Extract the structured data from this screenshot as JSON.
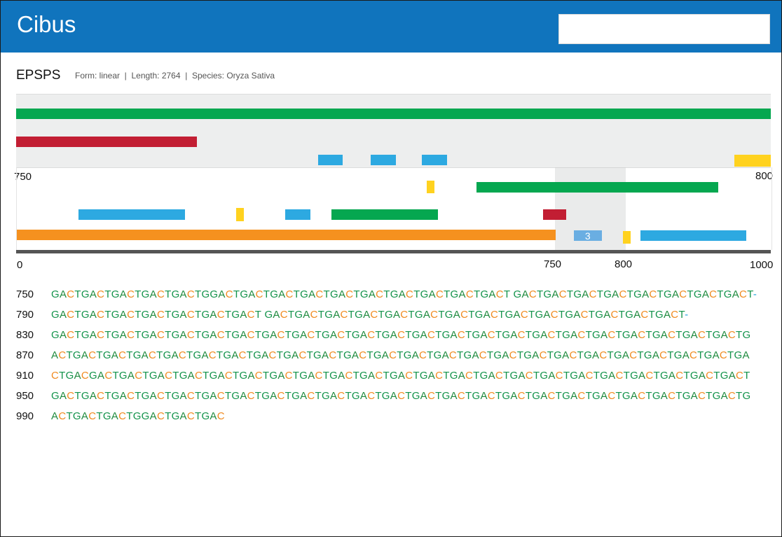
{
  "app": {
    "title": "Cibus"
  },
  "search": {
    "value": "",
    "placeholder": ""
  },
  "gene": {
    "name": "EPSPS",
    "meta": "Form: linear  |  Length: 2764  |  Species: Oryza Sativa"
  },
  "overview_features": [
    {
      "color": "#05a750",
      "start": 0,
      "end": 1000
    },
    {
      "color": "#c21e33",
      "start": 0,
      "end": 240
    },
    {
      "color": "#2da9e1",
      "start": 400,
      "end": 433
    },
    {
      "color": "#2da9e1",
      "start": 470,
      "end": 503
    },
    {
      "color": "#2da9e1",
      "start": 538,
      "end": 571
    },
    {
      "color": "#ffd21f",
      "start": 952,
      "end": 1000
    }
  ],
  "zoom_range": {
    "start_label": "750",
    "end_label": "800"
  },
  "detail_features": [
    {
      "color": "#ffd21f",
      "start": 543,
      "end": 553
    },
    {
      "color": "#05a750",
      "start": 609,
      "end": 929
    },
    {
      "color": "#2da9e1",
      "start": 82,
      "end": 223
    },
    {
      "color": "#ffd21f",
      "start": 291,
      "end": 301
    },
    {
      "color": "#2da9e1",
      "start": 356,
      "end": 389
    },
    {
      "color": "#05a750",
      "start": 417,
      "end": 558
    },
    {
      "color": "#c21e33",
      "start": 697,
      "end": 728
    },
    {
      "color": "#f5911f",
      "start": 0,
      "end": 714
    },
    {
      "color": "#6aaee2",
      "start": 738,
      "end": 775,
      "label": "3"
    },
    {
      "color": "#ffd21f",
      "start": 803,
      "end": 813
    },
    {
      "color": "#2da9e1",
      "start": 826,
      "end": 967
    }
  ],
  "axis_ticks": [
    "0",
    "750",
    "800",
    "1000"
  ],
  "sequence": [
    {
      "num": "750",
      "text": "GACTGACTGACTGACTGACTGGACTGACTGACTGACTGACTGACTGACTGACTGACTGACT GACTGACTGACTGACTGACTGACTGACTGACT-"
    },
    {
      "num": "790",
      "text": "GACTGACTGACTGACTGACTGACTGACT GACTGACTGACTGACTGACTGACTGACTGACTGACTGACTGACTGACTGACTGACT-"
    },
    {
      "num": "830",
      "text": "GACTGACTGACTGACTGACTGACTGACTGACTGACTGACTGACTGACTGACTGACTGACTGACTGACTGACTGACTGACTGACTGACTGACTG"
    },
    {
      "num": "870",
      "text": "ACTGACTGACTGACTGACTGACTGACTGACTGACTGACTGACTGACTGACTGACTGACTGACTGACTGACTGACTGACTGACTGACTGACTGA"
    },
    {
      "num": "910",
      "text": "CTGACGACTGACTGACTGACTGACTGACTGACTGACTGACTGACTGACTGACTGACTGACTGACTGACTGACTGACTGACTGACTGACTGACT"
    },
    {
      "num": "950",
      "text": "GACTGACTGACTGACTGACTGACTGACTGACTGACTGACTGACTGACTGACTGACTGACTGACTGACTGACTGACTGACTGACTGACTGACTG"
    },
    {
      "num": "990",
      "text": "ACTGACTGACTGGACTGACTGAC"
    }
  ]
}
